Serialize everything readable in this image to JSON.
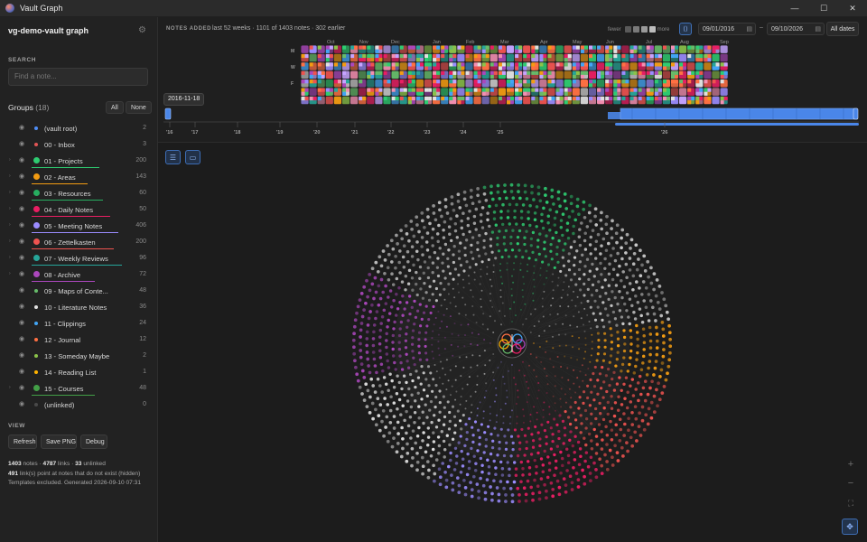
{
  "window": {
    "title": "Vault Graph",
    "controls": [
      "—",
      "☐",
      "✕"
    ]
  },
  "sidebar": {
    "vault_name": "vg-demo-vault graph",
    "search_label": "SEARCH",
    "search_placeholder": "Find a note...",
    "groups_label": "Groups",
    "groups_count": "(18)",
    "all_label": "All",
    "none_label": "None",
    "groups": [
      {
        "label": "(vault root)",
        "count": "2",
        "color": "#4f8ef7",
        "caret": false,
        "underline": false
      },
      {
        "label": "00 - Inbox",
        "count": "3",
        "color": "#e25555",
        "caret": false,
        "underline": false
      },
      {
        "label": "01 - Projects",
        "count": "200",
        "color": "#2ecc71",
        "caret": true,
        "underline": true
      },
      {
        "label": "02 - Areas",
        "count": "143",
        "color": "#f39c12",
        "caret": true,
        "underline": true
      },
      {
        "label": "03 - Resources",
        "count": "60",
        "color": "#27ae60",
        "caret": true,
        "underline": true
      },
      {
        "label": "04 - Daily Notes",
        "count": "50",
        "color": "#e91e63",
        "caret": true,
        "underline": true
      },
      {
        "label": "05 - Meeting Notes",
        "count": "406",
        "color": "#9b8cff",
        "caret": true,
        "underline": true
      },
      {
        "label": "06 - Zettelkasten",
        "count": "200",
        "color": "#ef5350",
        "caret": true,
        "underline": true
      },
      {
        "label": "07 - Weekly Reviews",
        "count": "96",
        "color": "#26a69a",
        "caret": true,
        "underline": true
      },
      {
        "label": "08 - Archive",
        "count": "72",
        "color": "#ab47bc",
        "caret": true,
        "underline": true
      },
      {
        "label": "09 - Maps of Conte...",
        "count": "48",
        "color": "#66bb6a",
        "caret": false,
        "underline": false
      },
      {
        "label": "10 - Literature Notes",
        "count": "36",
        "color": "#e0e0e0",
        "caret": false,
        "underline": false
      },
      {
        "label": "11 - Clippings",
        "count": "24",
        "color": "#42a5f5",
        "caret": false,
        "underline": false
      },
      {
        "label": "12 - Journal",
        "count": "12",
        "color": "#ff7043",
        "caret": false,
        "underline": false
      },
      {
        "label": "13 - Someday Maybe",
        "count": "2",
        "color": "#8bc34a",
        "caret": false,
        "underline": false
      },
      {
        "label": "14 - Reading List",
        "count": "1",
        "color": "#ffb300",
        "caret": false,
        "underline": false
      },
      {
        "label": "15 - Courses",
        "count": "48",
        "color": "#43a047",
        "caret": true,
        "underline": true
      },
      {
        "label": "(unlinked)",
        "count": "0",
        "color": "#4a4a4a",
        "caret": false,
        "underline": false
      }
    ],
    "view_label": "VIEW",
    "view_buttons": {
      "refresh": "Refresh",
      "save_png": "Save PNG",
      "debug": "Debug"
    },
    "stats": {
      "notes": "1403",
      "notes_word": "notes",
      "links": "4787",
      "links_word": "links",
      "unlinked": "33",
      "unlinked_word": "unlinked",
      "dangling": "491",
      "dangling_text": "link(s) point at notes that do not exist (hidden)",
      "footer": "Templates excluded. Generated 2026-09-10 07:31"
    }
  },
  "timeline": {
    "title": "NOTES ADDED",
    "summary": "last 52 weeks · 1101 of 1403 notes · 302 earlier",
    "legend_fewer": "fewer",
    "legend_more": "more",
    "legend_colors": [
      "#5a5a5a",
      "#7a7a7a",
      "#9a9a9a",
      "#bdbdbd"
    ],
    "date_from": "09/01/2016",
    "date_to": "09/10/2026",
    "date_separator": "–",
    "all_dates": "All dates",
    "months": [
      "Oct",
      "Nov",
      "Dec",
      "Jan",
      "Feb",
      "Mar",
      "Apr",
      "May",
      "Jun",
      "Jul",
      "Aug",
      "Sep"
    ],
    "weekdays": [
      "M",
      "W",
      "F"
    ],
    "brush_tooltip": "2016-11-18",
    "years": [
      "'16",
      "'17",
      "'18",
      "'19",
      "'20",
      "'21",
      "'22",
      "'23",
      "'24",
      "'25",
      "'26"
    ],
    "palette": [
      "#2ecc71",
      "#f39c12",
      "#9b8cff",
      "#ef5350",
      "#e91e63",
      "#26a69a",
      "#ab47bc",
      "#66bb6a",
      "#42a5f5",
      "#e0e0e0",
      "#ff7043",
      "#8bc34a",
      "#c5a3ff",
      "#f48fb1"
    ]
  },
  "graph": {
    "list_icon": "list-icon",
    "panel_icon": "panel-icon",
    "center_icon": "brain-icon",
    "zoom_in": "+",
    "zoom_out": "−",
    "fit": "fit-icon",
    "locate": "locate-icon"
  }
}
